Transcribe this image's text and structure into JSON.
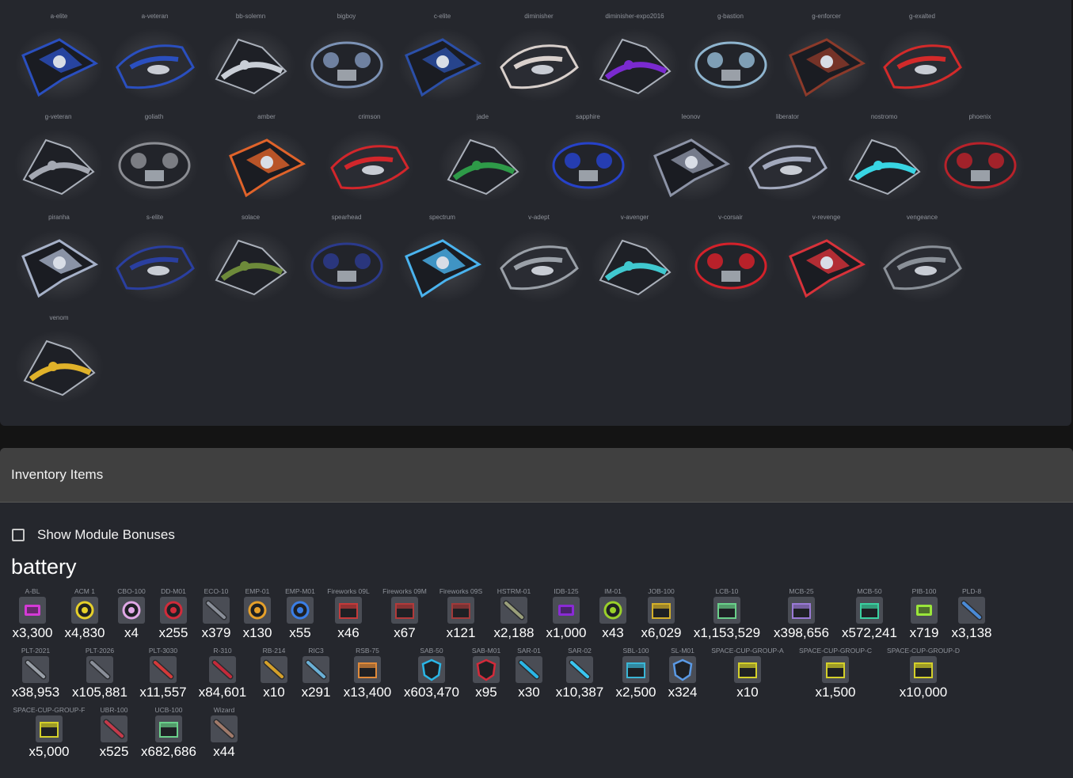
{
  "ships": [
    {
      "name": "a-elite",
      "color": "#2a4fbf"
    },
    {
      "name": "a-veteran",
      "color": "#2a4fbf"
    },
    {
      "name": "bb-solemn",
      "color": "#c9ced6"
    },
    {
      "name": "bigboy",
      "color": "#7c92b5"
    },
    {
      "name": "c-elite",
      "color": "#2b4fa8"
    },
    {
      "name": "diminisher",
      "color": "#d9d0cc"
    },
    {
      "name": "diminisher-expo2016",
      "color": "#7a2ad0"
    },
    {
      "name": "g-bastion",
      "color": "#8fb5cf"
    },
    {
      "name": "g-enforcer",
      "color": "#8c3a2a"
    },
    {
      "name": "g-exalted",
      "color": "#d32a2a"
    },
    {
      "name": "g-veteran",
      "color": "#a4a8b2"
    },
    {
      "name": "goliath",
      "color": "#8b8d93"
    },
    {
      "name": "amber",
      "color": "#e0632a"
    },
    {
      "name": "crimson",
      "color": "#d2262b"
    },
    {
      "name": "jade",
      "color": "#2e9a48"
    },
    {
      "name": "sapphire",
      "color": "#2642c9"
    },
    {
      "name": "leonov",
      "color": "#8c93a6"
    },
    {
      "name": "liberator",
      "color": "#a2a9bd"
    },
    {
      "name": "nostromo",
      "color": "#38d5e3"
    },
    {
      "name": "phoenix",
      "color": "#b8222a"
    },
    {
      "name": "piranha",
      "color": "#a6b1c8"
    },
    {
      "name": "s-elite",
      "color": "#2a3fa0"
    },
    {
      "name": "solace",
      "color": "#6d8a3a"
    },
    {
      "name": "spearhead",
      "color": "#2b3a8c"
    },
    {
      "name": "spectrum",
      "color": "#4ab3ee"
    },
    {
      "name": "v-adept",
      "color": "#9aa0a8"
    },
    {
      "name": "v-avenger",
      "color": "#40c8cf"
    },
    {
      "name": "v-corsair",
      "color": "#d4212a"
    },
    {
      "name": "v-revenge",
      "color": "#d8323a"
    },
    {
      "name": "vengeance",
      "color": "#8a9098"
    },
    {
      "name": "venom",
      "color": "#e0b22a"
    }
  ],
  "inventory": {
    "title": "Inventory Items",
    "module_toggle_label": "Show Module Bonuses",
    "module_toggle_checked": false,
    "category": "battery",
    "items": [
      {
        "code": "A-BL",
        "qty": "x3,300",
        "icon": "battery-magenta-icon",
        "color": "#d43ad6"
      },
      {
        "code": "ACM 1",
        "qty": "x4,830",
        "icon": "mine-yellow-icon",
        "color": "#e6d02a"
      },
      {
        "code": "CBO-100",
        "qty": "x4",
        "icon": "ball-pink-icon",
        "color": "#e0a8e6"
      },
      {
        "code": "DD-M01",
        "qty": "x255",
        "icon": "mine-red-icon",
        "color": "#d12b3a"
      },
      {
        "code": "ECO-10",
        "qty": "x379",
        "icon": "rocket-icon",
        "color": "#8a8f99"
      },
      {
        "code": "EMP-01",
        "qty": "x130",
        "icon": "emp-icon",
        "color": "#e6a02a"
      },
      {
        "code": "EMP-M01",
        "qty": "x55",
        "icon": "emp-blue-icon",
        "color": "#3a7ee6"
      },
      {
        "code": "Fireworks 09L",
        "qty": "x46",
        "icon": "fireworks-icon",
        "color": "#c43a3a"
      },
      {
        "code": "Fireworks 09M",
        "qty": "x67",
        "icon": "fireworks-icon",
        "color": "#b23a3a"
      },
      {
        "code": "Fireworks 09S",
        "qty": "x121",
        "icon": "fireworks-icon",
        "color": "#a03a3a"
      },
      {
        "code": "HSTRM-01",
        "qty": "x2,188",
        "icon": "rocket-icon",
        "color": "#9a9f7a"
      },
      {
        "code": "IDB-125",
        "qty": "x1,000",
        "icon": "battery-purple-icon",
        "color": "#8a2ad6"
      },
      {
        "code": "IM-01",
        "qty": "x43",
        "icon": "mine-green-icon",
        "color": "#9ad02a"
      },
      {
        "code": "JOB-100",
        "qty": "x6,029",
        "icon": "box-gold-icon",
        "color": "#d4b02a"
      },
      {
        "code": "LCB-10",
        "qty": "x1,153,529",
        "icon": "box-green-icon",
        "color": "#6ad08a"
      },
      {
        "code": "MCB-25",
        "qty": "x398,656",
        "icon": "box-purple-icon",
        "color": "#9a7ad6"
      },
      {
        "code": "MCB-50",
        "qty": "x572,241",
        "icon": "box-teal-icon",
        "color": "#3ad0a0"
      },
      {
        "code": "PIB-100",
        "qty": "x719",
        "icon": "battery-lime-icon",
        "color": "#9ae63a"
      },
      {
        "code": "PLD-8",
        "qty": "x3,138",
        "icon": "rocket-blue-icon",
        "color": "#4a8ad6"
      },
      {
        "code": "PLT-2021",
        "qty": "x38,953",
        "icon": "rocket-icon",
        "color": "#9aa0a8"
      },
      {
        "code": "PLT-2026",
        "qty": "x105,881",
        "icon": "rocket-icon",
        "color": "#8a8f99"
      },
      {
        "code": "PLT-3030",
        "qty": "x11,557",
        "icon": "rocket-red-icon",
        "color": "#d43a3a"
      },
      {
        "code": "R-310",
        "qty": "x84,601",
        "icon": "rocket-red-icon",
        "color": "#c42a3a"
      },
      {
        "code": "RB-214",
        "qty": "x10",
        "icon": "rocket-gold-icon",
        "color": "#d4a02a"
      },
      {
        "code": "RIC3",
        "qty": "x291",
        "icon": "rocket-cyan-icon",
        "color": "#6ab0d6"
      },
      {
        "code": "RSB-75",
        "qty": "x13,400",
        "icon": "box-orange-icon",
        "color": "#e08a3a"
      },
      {
        "code": "SAB-50",
        "qty": "x603,470",
        "icon": "shield-cyan-icon",
        "color": "#2ab6e6"
      },
      {
        "code": "SAB-M01",
        "qty": "x95",
        "icon": "shield-red-icon",
        "color": "#d42a3a"
      },
      {
        "code": "SAR-01",
        "qty": "x30",
        "icon": "rocket-cyan-icon",
        "color": "#2ab6e6"
      },
      {
        "code": "SAR-02",
        "qty": "x10,387",
        "icon": "rocket-cyan-icon",
        "color": "#3ac6f0"
      },
      {
        "code": "SBL-100",
        "qty": "x2,500",
        "icon": "box-cyan-icon",
        "color": "#3ab6d6"
      },
      {
        "code": "SL-M01",
        "qty": "x324",
        "icon": "shield-blue-icon",
        "color": "#5a9ae6"
      },
      {
        "code": "SPACE-CUP-GROUP-A",
        "qty": "x10",
        "icon": "box-cup-icon",
        "color": "#d4d02a"
      },
      {
        "code": "SPACE-CUP-GROUP-C",
        "qty": "x1,500",
        "icon": "box-cup-icon",
        "color": "#d4d02a"
      },
      {
        "code": "SPACE-CUP-GROUP-D",
        "qty": "x10,000",
        "icon": "box-cup-icon",
        "color": "#d4d02a"
      },
      {
        "code": "SPACE-CUP-GROUP-F",
        "qty": "x5,000",
        "icon": "box-cup-icon",
        "color": "#d4d02a"
      },
      {
        "code": "UBR-100",
        "qty": "x525",
        "icon": "rocket-red-icon",
        "color": "#c43a4a"
      },
      {
        "code": "UCB-100",
        "qty": "x682,686",
        "icon": "box-green-icon",
        "color": "#6ad08a"
      },
      {
        "code": "Wizard",
        "qty": "x44",
        "icon": "rocket-icon",
        "color": "#a07a6a"
      }
    ]
  }
}
